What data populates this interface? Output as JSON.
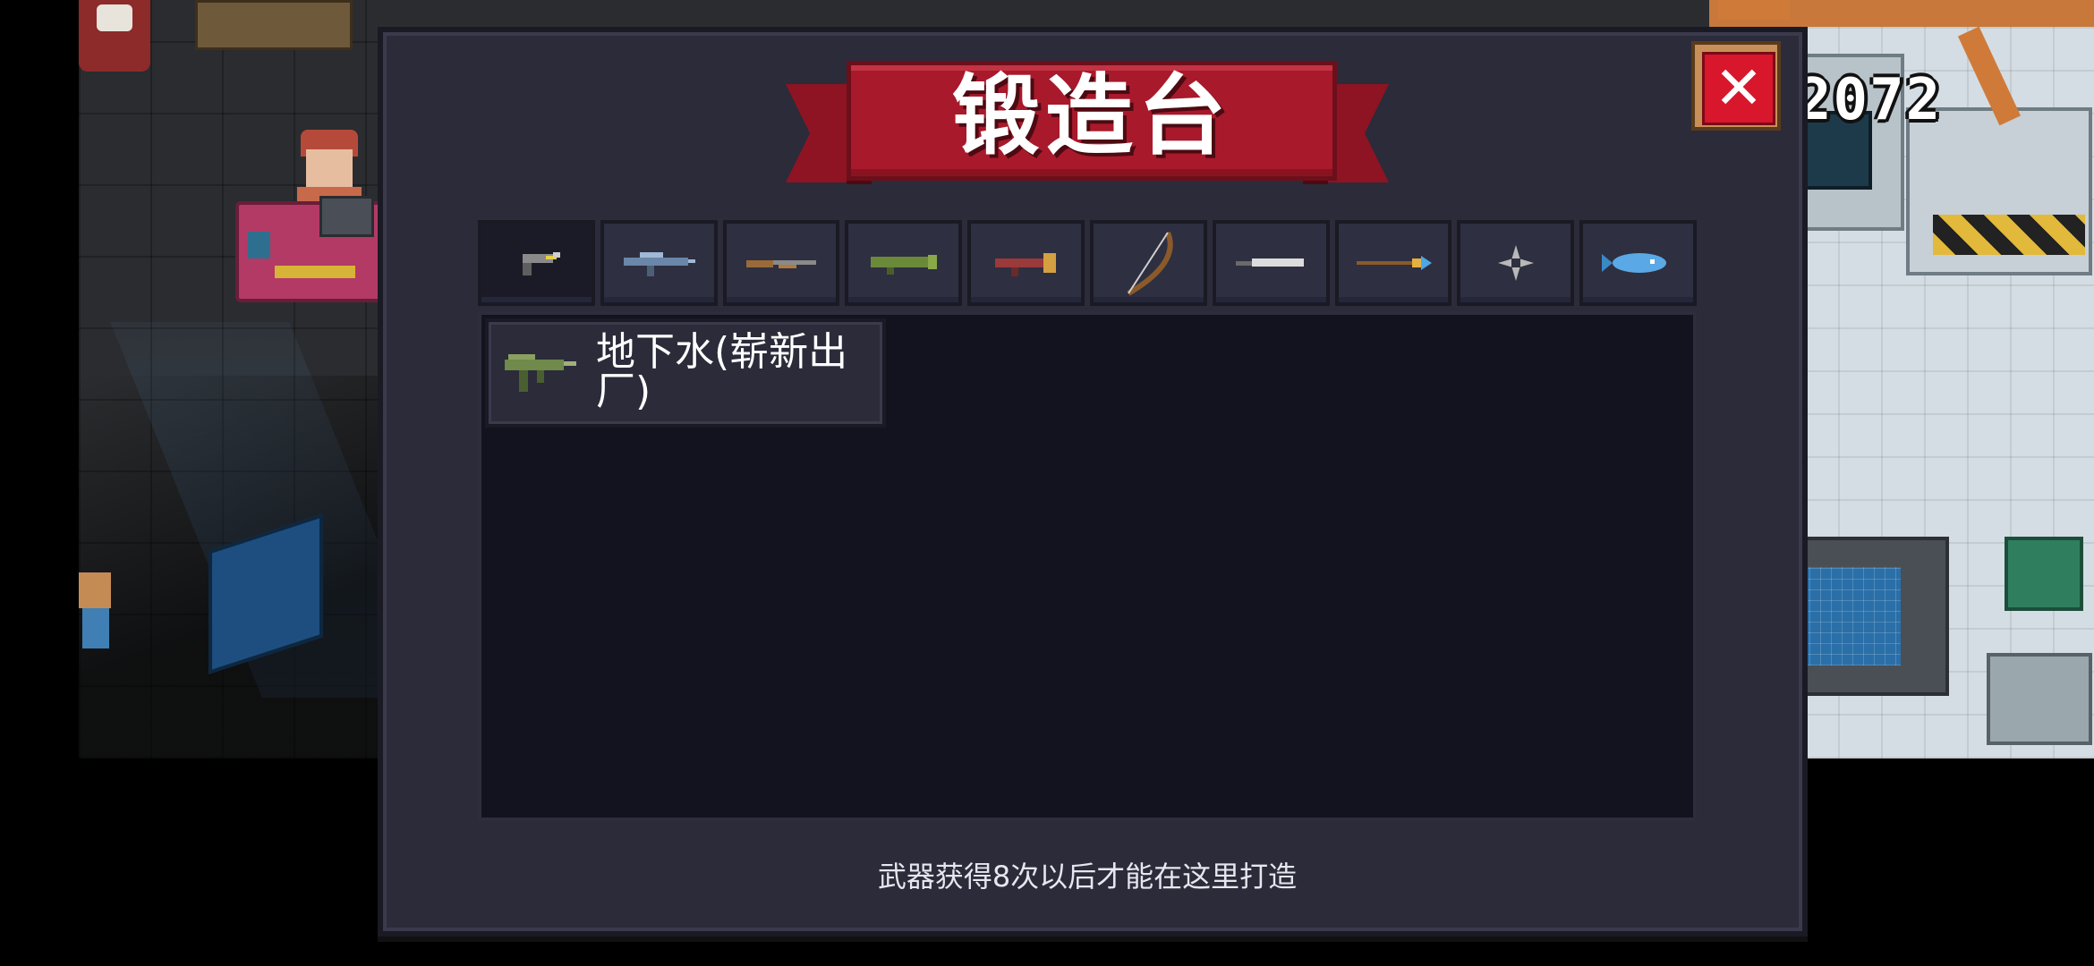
{
  "hud": {
    "counter": "2072"
  },
  "forge": {
    "title": "锻造台",
    "close_label": "✕",
    "categories": [
      {
        "icon": "pistol-icon"
      },
      {
        "icon": "rifle-icon"
      },
      {
        "icon": "shotgun-icon"
      },
      {
        "icon": "rocket-launcher-icon"
      },
      {
        "icon": "launcher-icon"
      },
      {
        "icon": "bow-icon"
      },
      {
        "icon": "sword-icon"
      },
      {
        "icon": "spear-icon"
      },
      {
        "icon": "shuriken-icon"
      },
      {
        "icon": "fish-icon"
      }
    ],
    "items": [
      {
        "name": "地下水(崭新出厂)",
        "icon": "smg-icon"
      }
    ],
    "footer_text": "武器获得8次以后才能在这里打造"
  },
  "colors": {
    "panel_bg": "#2b2b3a",
    "banner_red": "#a8192b",
    "close_red": "#d8162c",
    "list_bg": "#13131f"
  }
}
